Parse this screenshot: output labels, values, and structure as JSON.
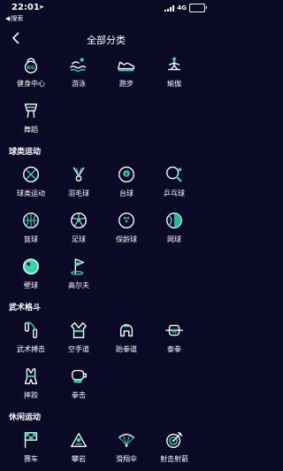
{
  "status": {
    "time": "22:01",
    "network": "4G",
    "battery_level": 0.85
  },
  "back_app": "搜索",
  "nav": {
    "title": "全部分类"
  },
  "top_items": [
    {
      "label": "健身中心",
      "icon": "kettlebell-icon"
    },
    {
      "label": "游泳",
      "icon": "swimmer-icon"
    },
    {
      "label": "跑步",
      "icon": "running-shoe-icon"
    },
    {
      "label": "瑜伽",
      "icon": "yoga-icon"
    },
    {
      "label": "舞蹈",
      "icon": "dance-icon"
    }
  ],
  "sections": [
    {
      "title": "球类运动",
      "items": [
        {
          "label": "球类运动",
          "icon": "balls-icon"
        },
        {
          "label": "羽毛球",
          "icon": "shuttlecock-icon"
        },
        {
          "label": "台球",
          "icon": "billiard-ball-icon"
        },
        {
          "label": "乒乓球",
          "icon": "ping-pong-paddle-icon"
        },
        {
          "label": "篮球",
          "icon": "basketball-icon"
        },
        {
          "label": "足球",
          "icon": "soccer-ball-icon"
        },
        {
          "label": "保龄球",
          "icon": "bowling-ball-icon"
        },
        {
          "label": "网球",
          "icon": "tennis-ball-icon"
        },
        {
          "label": "壁球",
          "icon": "squash-ball-icon"
        },
        {
          "label": "高尔夫",
          "icon": "golf-flag-icon"
        }
      ]
    },
    {
      "title": "武术格斗",
      "items": [
        {
          "label": "武术搏击",
          "icon": "nunchaku-icon"
        },
        {
          "label": "空手道",
          "icon": "karate-uniform-icon"
        },
        {
          "label": "跆拳道",
          "icon": "taekwondo-helmet-icon"
        },
        {
          "label": "泰拳",
          "icon": "muay-thai-belt-icon"
        },
        {
          "label": "摔跤",
          "icon": "wrestling-singlet-icon"
        },
        {
          "label": "拳击",
          "icon": "boxing-glove-icon"
        }
      ]
    },
    {
      "title": "休闲运动",
      "items": [
        {
          "label": "赛车",
          "icon": "racing-flag-icon"
        },
        {
          "label": "攀岩",
          "icon": "rock-climbing-icon"
        },
        {
          "label": "滑翔伞",
          "icon": "paraglider-icon"
        },
        {
          "label": "射击射箭",
          "icon": "target-icon"
        }
      ]
    }
  ],
  "colors": {
    "background": "#0b0a26",
    "accent": "#2ed8a8",
    "icon_stroke": "#ffffff"
  }
}
